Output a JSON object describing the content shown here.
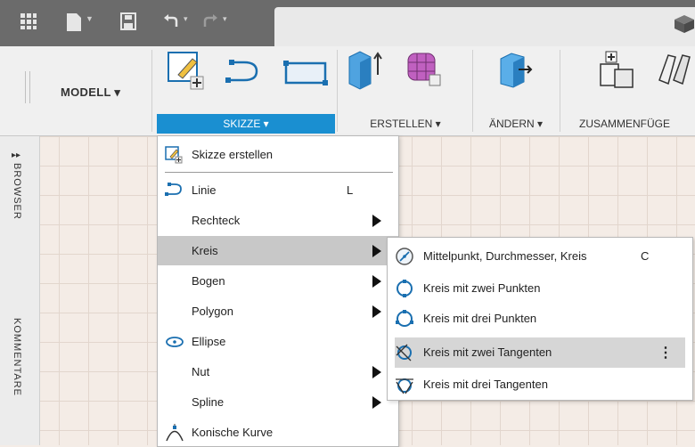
{
  "toolbar": {
    "undo_caret": "▾",
    "redo_caret": "▾"
  },
  "ribbon": {
    "workspace_label": "MODELL",
    "groups": [
      {
        "label": "SKIZZE"
      },
      {
        "label": "ERSTELLEN"
      },
      {
        "label": "ÄNDERN"
      },
      {
        "label": "ZUSAMMENFÜGE"
      }
    ]
  },
  "side_panel": {
    "browser_label": "BROWSER",
    "comments_label": "KOMMENTARE"
  },
  "sketch_menu": {
    "items": [
      {
        "label": "Skizze erstellen",
        "shortcut": ""
      },
      {
        "label": "Linie",
        "shortcut": "L"
      },
      {
        "label": "Rechteck",
        "shortcut": ""
      },
      {
        "label": "Kreis",
        "shortcut": ""
      },
      {
        "label": "Bogen",
        "shortcut": ""
      },
      {
        "label": "Polygon",
        "shortcut": ""
      },
      {
        "label": "Ellipse",
        "shortcut": ""
      },
      {
        "label": "Nut",
        "shortcut": ""
      },
      {
        "label": "Spline",
        "shortcut": ""
      },
      {
        "label": "Konische Kurve",
        "shortcut": ""
      }
    ]
  },
  "circle_submenu": {
    "items": [
      {
        "label": "Mittelpunkt, Durchmesser, Kreis",
        "shortcut": "C"
      },
      {
        "label": "Kreis mit zwei Punkten",
        "shortcut": ""
      },
      {
        "label": "Kreis mit drei Punkten",
        "shortcut": ""
      },
      {
        "label": "Kreis mit zwei Tangenten",
        "shortcut": ""
      },
      {
        "label": "Kreis mit drei Tangenten",
        "shortcut": ""
      }
    ]
  },
  "colors": {
    "accent": "#1a8fd1",
    "icon_blue": "#2a8ad4",
    "highlight": "#c8c8c8",
    "toolbar_bg": "#6b6b6b"
  }
}
